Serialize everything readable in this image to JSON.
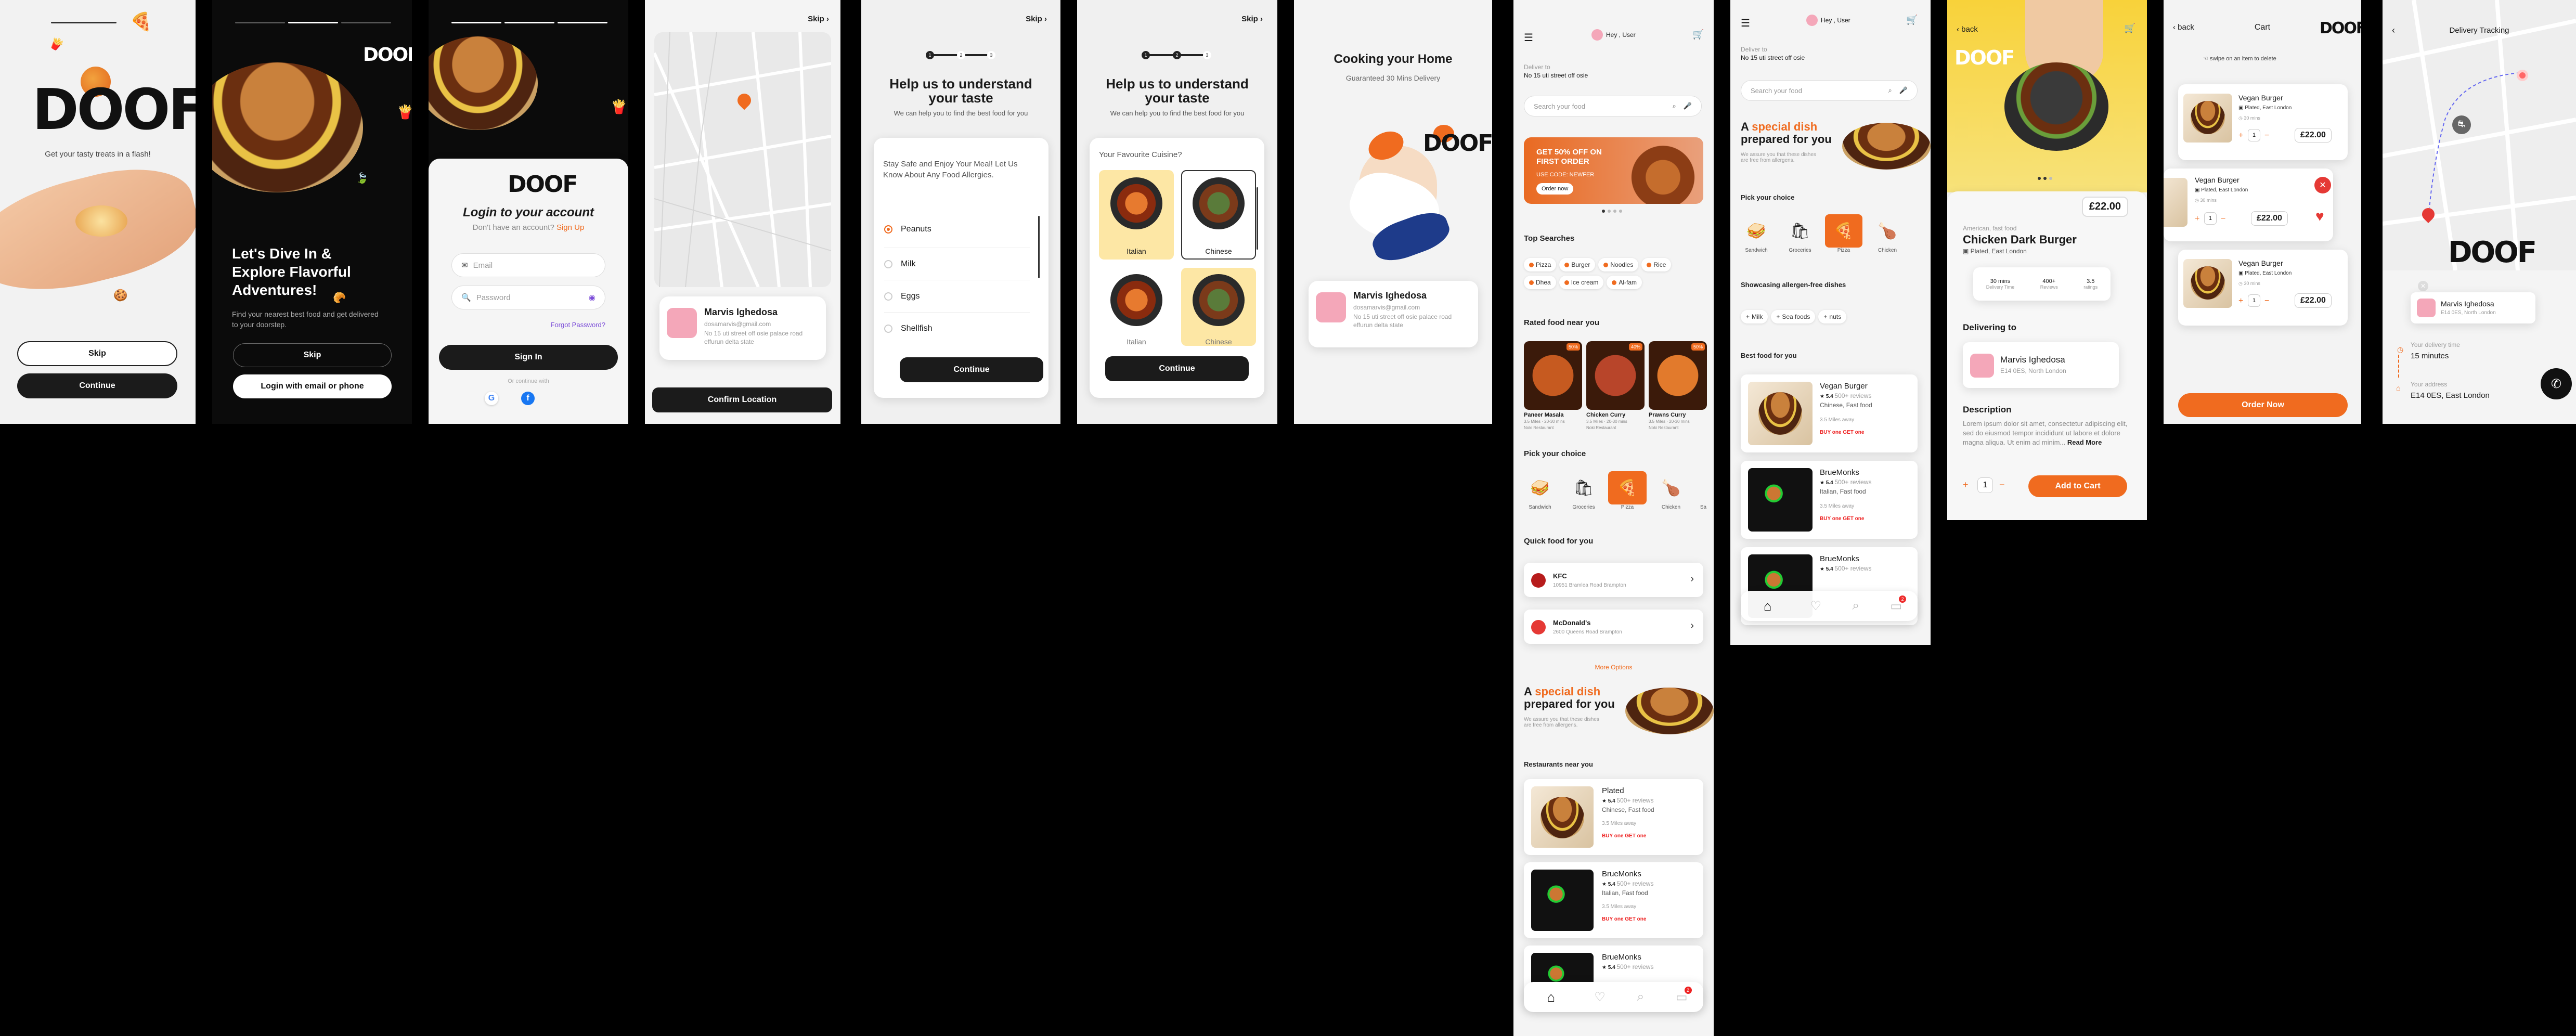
{
  "s1": {
    "logo": "DOOF",
    "tagline": "Get your tasty treats in a flash!",
    "skip": "Skip",
    "continue": "Continue"
  },
  "s2": {
    "logo": "DOOF",
    "title": "Let's Dive In & Explore Flavorful Adventures!",
    "sub": "Find your nearest best food and get delivered to your doorstep.",
    "skip": "Skip",
    "login_email": "Login with email or phone"
  },
  "s3": {
    "logo": "DOOF",
    "title": "Login to your account",
    "no_account": "Don't have an account?",
    "signup": "Sign Up",
    "email_ph": "Email",
    "password_ph": "Password",
    "forgot": "Forgot Password?",
    "signin": "Sign In",
    "or": "Or continue with"
  },
  "s4": {
    "skip": "Skip",
    "name": "Marvis Ighedosa",
    "email": "dosamarvis@gmail.com",
    "addr": "No 15 uti street off osie palace road effurun delta state",
    "confirm": "Confirm Location"
  },
  "s5": {
    "skip": "Skip",
    "title": "Help us to understand your taste",
    "sub": "We can help you to find the best food for you",
    "steps": [
      "1",
      "2",
      "3"
    ],
    "question": "Stay Safe and Enjoy Your Meal! Let Us Know About Any Food Allergies.",
    "options": [
      "Peanuts",
      "Milk",
      "Eggs",
      "Shellfish"
    ],
    "continue": "Continue"
  },
  "s6": {
    "skip": "Skip",
    "title": "Help us to understand your taste",
    "sub": "We can help you to find the best food for you",
    "steps": [
      "1",
      "2",
      "3"
    ],
    "question": "Your Favourite Cuisine?",
    "cuisines": [
      "Italian",
      "Chinese",
      "Italian",
      "Chinese"
    ],
    "continue": "Continue"
  },
  "s7": {
    "title": "Cooking your Home",
    "sub": "Guaranteed 30 Mins Delivery",
    "logo": "DOOF",
    "name": "Marvis Ighedosa",
    "email": "dosamarvis@gmail.com",
    "addr": "No 15 uti street off osie palace road effurun delta state"
  },
  "s8": {
    "greeting": "Hey , User",
    "deliver_to": "Deliver to",
    "address": "No 15 uti street off osie",
    "search_ph": "Search your food",
    "promo_title": "GET 50% OFF ON FIRST ORDER",
    "promo_code": "USE CODE: NEWFER",
    "promo_btn": "Order now",
    "top_searches": "Top Searches",
    "chips": [
      "Pizza",
      "Burger",
      "Noodles",
      "Rice",
      "Dhea",
      "Ice cream",
      "Al-fam"
    ],
    "rated": "Rated food near you",
    "rated_items": [
      {
        "name": "Paneer Masala",
        "badge": "50%",
        "meta": "3.5 Miles · 20-30 mins",
        "sub": "Noki Restaurant"
      },
      {
        "name": "Chicken Curry",
        "badge": "40%",
        "meta": "3.5 Miles · 20-30 mins",
        "sub": "Noki Restaurant"
      },
      {
        "name": "Prawns Curry",
        "badge": "50%",
        "meta": "3.5 Miles · 20-30 mins",
        "sub": "Noki Restaurant"
      }
    ],
    "pick": "Pick your choice",
    "picks": [
      "Sandwich",
      "Groceries",
      "Pizza",
      "Chicken",
      "Sa"
    ],
    "quick": "Quick food for you",
    "quick_items": [
      {
        "name": "KFC",
        "addr": "10951 Bramlea Road Brampton"
      },
      {
        "name": "McDonald's",
        "addr": "2600 Queens Road Brampton"
      }
    ],
    "more": "More Options",
    "special_pre": "A",
    "special_word": "special dish",
    "special_post": "prepared for you",
    "special_sub": "We assure you that these dishes are free from allergens.",
    "restaurants": "Restaurants near you",
    "rest_items": [
      {
        "name": "Plated",
        "rating": "5.4",
        "reviews": "500+ reviews",
        "cuisine": "Chinese, Fast food",
        "dist": "3.5 Miles away",
        "offer": "BUY one GET one"
      },
      {
        "name": "BrueMonks",
        "rating": "5.4",
        "reviews": "500+ reviews",
        "cuisine": "Italian, Fast food",
        "dist": "3.5 Miles away",
        "offer": "BUY one GET one"
      },
      {
        "name": "BrueMonks",
        "rating": "5.4",
        "reviews": "500+ reviews"
      }
    ],
    "cart_badge": "2"
  },
  "s9": {
    "greeting": "Hey , User",
    "deliver_to": "Deliver to",
    "address": "No 15 uti street off osie",
    "search_ph": "Search your food",
    "special_pre": "A",
    "special_word": "special dish",
    "special_post": "prepared for you",
    "special_sub": "We assure you that these dishes are free from allergens.",
    "pick": "Pick your choice",
    "picks": [
      "Sandwich",
      "Groceries",
      "Pizza",
      "Chicken"
    ],
    "allergen": "Showcasing allergen-free dishes",
    "allergen_chips": [
      "Milk",
      "Sea foods",
      "nuts"
    ],
    "best": "Best food for you",
    "items": [
      {
        "name": "Vegan Burger",
        "rating": "5.4",
        "reviews": "500+ reviews",
        "cuisine": "Chinese, Fast food",
        "dist": "3.5 Miles away",
        "offer": "BUY one GET one"
      },
      {
        "name": "BrueMonks",
        "rating": "5.4",
        "reviews": "500+ reviews",
        "cuisine": "Italian, Fast food",
        "dist": "3.5 Miles away",
        "offer": "BUY one GET one"
      },
      {
        "name": "BrueMonks",
        "rating": "5.4",
        "reviews": "500+ reviews"
      }
    ],
    "cart_badge": "2"
  },
  "s10": {
    "back": "back",
    "logo": "DOOF",
    "price": "£22.00",
    "cat": "American, fast food",
    "name": "Chicken Dark Burger",
    "rest": "Plated, East London",
    "stats": [
      {
        "v": "30 mins",
        "l": "Delivery Time"
      },
      {
        "v": "400+",
        "l": "Reviews"
      },
      {
        "v": "3.5",
        "l": "ratings"
      }
    ],
    "deliver": "Delivering to",
    "dname": "Marvis Ighedosa",
    "daddr": "E14 0ES, North London",
    "desc_h": "Description",
    "desc": "Lorem ipsum dolor sit amet, consectetur adipiscing elit, sed do eiusmod tempor incididunt ut labore et dolore magna aliqua. Ut enim ad minim",
    "read_more": "Read More",
    "qty": "1",
    "add": "Add to Cart"
  },
  "s11": {
    "back": "back",
    "title": "Cart",
    "logo": "DOOF",
    "hint": "swipe on an item to delete",
    "items": [
      {
        "name": "Vegan Burger",
        "rest": "Plated, East London",
        "time": "30 mins",
        "qty": "1",
        "price": "£22.00"
      },
      {
        "name": "Vegan Burger",
        "rest": "Plated, East London",
        "time": "30 mins",
        "qty": "1",
        "price": "£22.00"
      },
      {
        "name": "Vegan Burger",
        "rest": "Plated, East London",
        "time": "30 mins",
        "qty": "1",
        "price": "£22.00"
      }
    ],
    "order": "Order Now"
  },
  "s12": {
    "title": "Delivery Tracking",
    "logo": "DOOF",
    "name": "Marvis Ighedosa",
    "addr": "E14 0ES, North London",
    "time_l": "Your delivery time",
    "time_v": "15 minutes",
    "addr_l": "Your address",
    "addr_v": "E14 0ES, East London"
  }
}
